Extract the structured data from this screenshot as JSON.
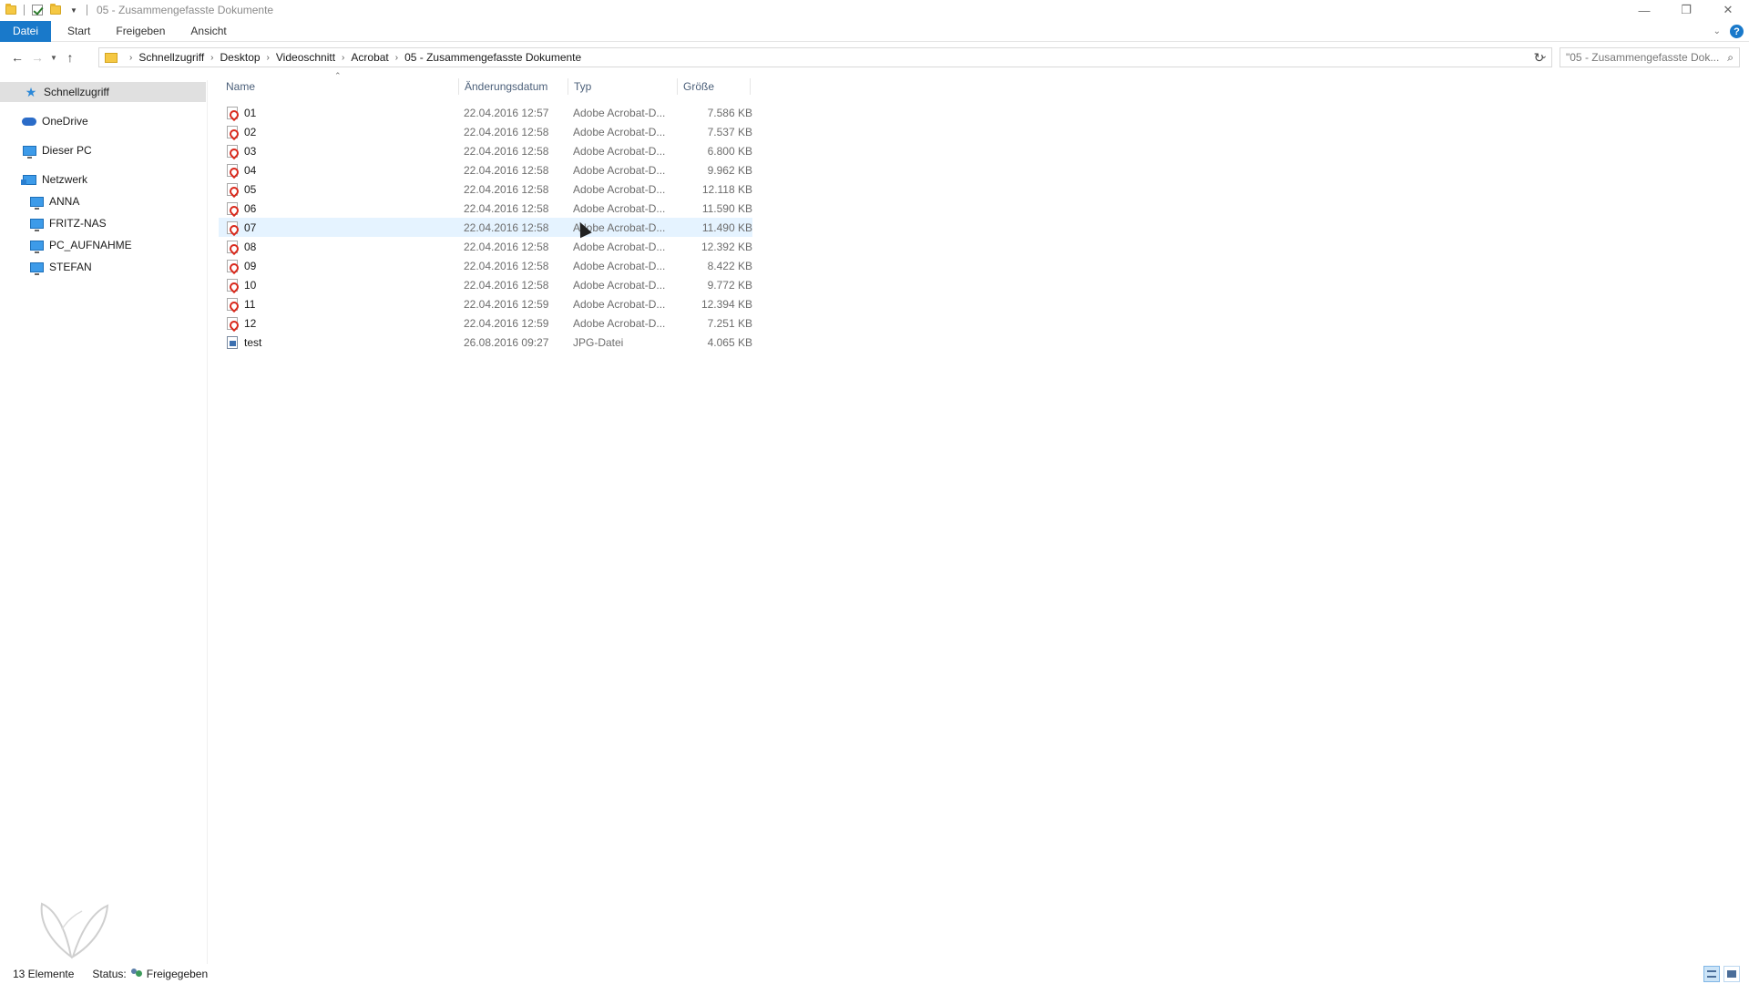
{
  "window": {
    "title": "05 - Zusammengefasste Dokumente",
    "controls": {
      "minimize": "—",
      "maximize": "❐",
      "close": "✕"
    }
  },
  "ribbon": {
    "tabs": [
      "Datei",
      "Start",
      "Freigeben",
      "Ansicht"
    ],
    "help": "?"
  },
  "address": {
    "crumbs": [
      "Schnellzugriff",
      "Desktop",
      "Videoschnitt",
      "Acrobat",
      "05 - Zusammengefasste Dokumente"
    ]
  },
  "search": {
    "placeholder": "\"05 - Zusammengefasste Dok..."
  },
  "sidebar": {
    "items": [
      {
        "label": "Schnellzugriff",
        "icon": "star-icon"
      },
      {
        "label": "OneDrive",
        "icon": "cloud-icon"
      },
      {
        "label": "Dieser PC",
        "icon": "computer-icon"
      },
      {
        "label": "Netzwerk",
        "icon": "network-icon"
      },
      {
        "label": "ANNA",
        "icon": "computer-icon"
      },
      {
        "label": "FRITZ-NAS",
        "icon": "computer-icon"
      },
      {
        "label": "PC_AUFNAHME",
        "icon": "computer-icon"
      },
      {
        "label": "STEFAN",
        "icon": "computer-icon"
      }
    ]
  },
  "columns": {
    "name": "Name",
    "date": "Änderungsdatum",
    "type": "Typ",
    "size": "Größe"
  },
  "files": [
    {
      "name": "01",
      "date": "22.04.2016 12:57",
      "type": "Adobe Acrobat-D...",
      "size": "7.586 KB",
      "icon": "pdf-icon"
    },
    {
      "name": "02",
      "date": "22.04.2016 12:58",
      "type": "Adobe Acrobat-D...",
      "size": "7.537 KB",
      "icon": "pdf-icon"
    },
    {
      "name": "03",
      "date": "22.04.2016 12:58",
      "type": "Adobe Acrobat-D...",
      "size": "6.800 KB",
      "icon": "pdf-icon"
    },
    {
      "name": "04",
      "date": "22.04.2016 12:58",
      "type": "Adobe Acrobat-D...",
      "size": "9.962 KB",
      "icon": "pdf-icon"
    },
    {
      "name": "05",
      "date": "22.04.2016 12:58",
      "type": "Adobe Acrobat-D...",
      "size": "12.118 KB",
      "icon": "pdf-icon"
    },
    {
      "name": "06",
      "date": "22.04.2016 12:58",
      "type": "Adobe Acrobat-D...",
      "size": "11.590 KB",
      "icon": "pdf-icon"
    },
    {
      "name": "07",
      "date": "22.04.2016 12:58",
      "type": "Adobe Acrobat-D...",
      "size": "11.490 KB",
      "icon": "pdf-icon"
    },
    {
      "name": "08",
      "date": "22.04.2016 12:58",
      "type": "Adobe Acrobat-D...",
      "size": "12.392 KB",
      "icon": "pdf-icon"
    },
    {
      "name": "09",
      "date": "22.04.2016 12:58",
      "type": "Adobe Acrobat-D...",
      "size": "8.422 KB",
      "icon": "pdf-icon"
    },
    {
      "name": "10",
      "date": "22.04.2016 12:58",
      "type": "Adobe Acrobat-D...",
      "size": "9.772 KB",
      "icon": "pdf-icon"
    },
    {
      "name": "11",
      "date": "22.04.2016 12:59",
      "type": "Adobe Acrobat-D...",
      "size": "12.394 KB",
      "icon": "pdf-icon"
    },
    {
      "name": "12",
      "date": "22.04.2016 12:59",
      "type": "Adobe Acrobat-D...",
      "size": "7.251 KB",
      "icon": "pdf-icon"
    },
    {
      "name": "test",
      "date": "26.08.2016 09:27",
      "type": "JPG-Datei",
      "size": "4.065 KB",
      "icon": "jpg-icon"
    }
  ],
  "status": {
    "count": "13 Elemente",
    "label": "Status:",
    "shared": "Freigegeben"
  },
  "colors": {
    "accent": "#1979ca",
    "hover_row": "#e5f3ff",
    "selected_nav": "#e0e0e0"
  }
}
